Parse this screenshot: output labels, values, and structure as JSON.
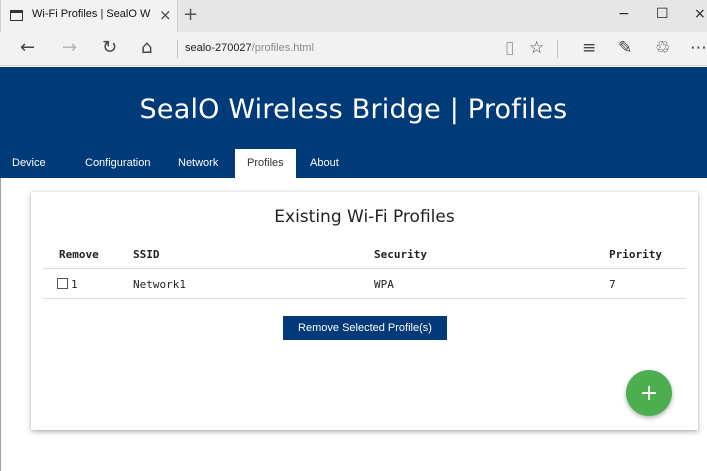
{
  "browser": {
    "tab_title": "Wi-Fi Profiles | SealO W",
    "tab_close": "×",
    "new_tab": "+",
    "window_controls": {
      "minimize": "−",
      "maximize": "☐",
      "close": "×"
    },
    "nav": {
      "back": "←",
      "forward": "→",
      "refresh": "↻",
      "home": "⌂"
    },
    "url_host": "sealo-270027",
    "url_path": "/profiles.html",
    "toolbar": {
      "reading_view": "▯",
      "favorite": "☆",
      "hub": "≡",
      "notes": "✎",
      "share": "♲",
      "more": "⋯"
    }
  },
  "header": {
    "title": "SealO Wireless Bridge | Profiles",
    "nav_items": [
      {
        "label": "Device"
      },
      {
        "label": "Configuration"
      },
      {
        "label": "Network"
      },
      {
        "label": "Profiles",
        "active": true
      },
      {
        "label": "About"
      }
    ]
  },
  "profiles": {
    "heading": "Existing Wi-Fi Profiles",
    "columns": [
      "Remove",
      "SSID",
      "Security",
      "Priority"
    ],
    "rows": [
      {
        "id": "1",
        "ssid": "Network1",
        "security": "WPA",
        "priority": "7",
        "checked": false
      }
    ],
    "remove_button": "Remove Selected Profile(s)",
    "add_button": "+"
  },
  "colors": {
    "header_bg": "#003a78",
    "button_bg": "#003a78",
    "fab_bg": "#4cae4f"
  }
}
